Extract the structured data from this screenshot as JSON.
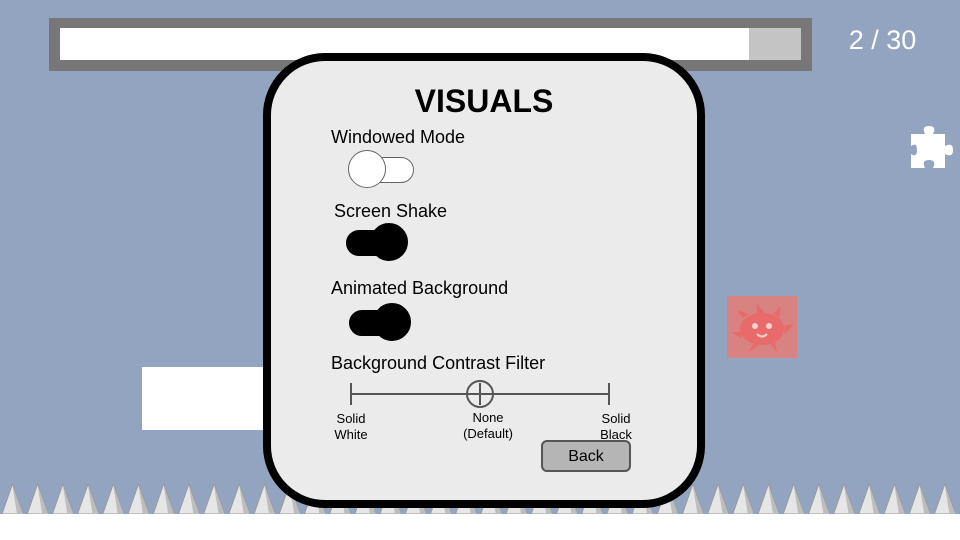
{
  "hud": {
    "progress_fraction": 0.93,
    "level_counter": "2 / 30"
  },
  "dialog": {
    "title": "VISUALS",
    "options": {
      "windowed_mode": {
        "label": "Windowed Mode",
        "enabled": false
      },
      "screen_shake": {
        "label": "Screen Shake",
        "enabled": true
      },
      "animated_background": {
        "label": "Animated Background",
        "enabled": true
      }
    },
    "contrast_filter": {
      "label": "Background Contrast Filter",
      "stops": [
        {
          "line1": "Solid",
          "line2": "White"
        },
        {
          "line1": "None",
          "line2": "(Default)"
        },
        {
          "line1": "Solid",
          "line2": "Black"
        }
      ],
      "selected_index": 1
    },
    "back_label": "Back"
  },
  "colors": {
    "background": "#93a4c1",
    "enemy": "#d98282"
  },
  "icons": [
    "puzzle-piece-icon",
    "spiky-blob-enemy-icon"
  ]
}
